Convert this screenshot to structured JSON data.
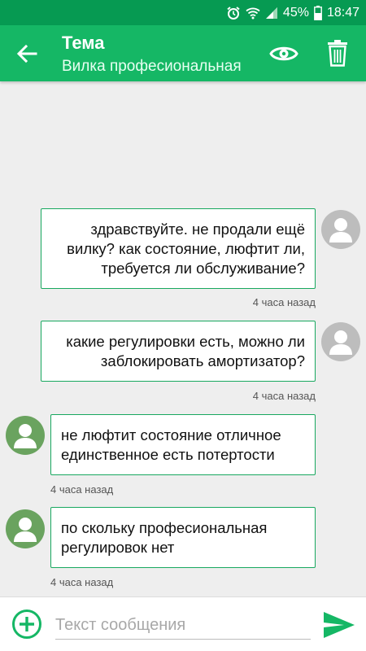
{
  "status_bar": {
    "battery_percent": "45%",
    "time": "18:47",
    "icons": [
      "alarm-icon",
      "wifi-icon",
      "signal-icon",
      "battery-icon"
    ]
  },
  "toolbar": {
    "title": "Тема",
    "subtitle": "Вилка професиональная",
    "icons": [
      "back-arrow-icon",
      "eye-icon",
      "trash-icon"
    ]
  },
  "messages": [
    {
      "direction": "outgoing",
      "text": "здравствуйте. не продали ещё вилку? как состояние, люфтит ли, требуется ли обслуживание?",
      "time": "4 часа назад"
    },
    {
      "direction": "outgoing",
      "text": "какие регулировки есть, можно ли заблокировать амортизатор?",
      "time": "4 часа назад"
    },
    {
      "direction": "incoming",
      "text": "не люфтит состояние отличное единственное есть потертости",
      "time": "4 часа назад"
    },
    {
      "direction": "incoming",
      "text": "по скольку професиональная регулировок нет",
      "time": "4 часа назад"
    }
  ],
  "composer": {
    "placeholder": "Текст сообщения",
    "value": "",
    "icons": [
      "add-circle-icon",
      "send-icon"
    ]
  },
  "colors": {
    "status_bar": "#069a52",
    "toolbar": "#15b765",
    "accent": "#18a85f",
    "incoming_avatar": "#6aa35f",
    "outgoing_avatar": "#bdbdbd",
    "background": "#eeeeee"
  }
}
